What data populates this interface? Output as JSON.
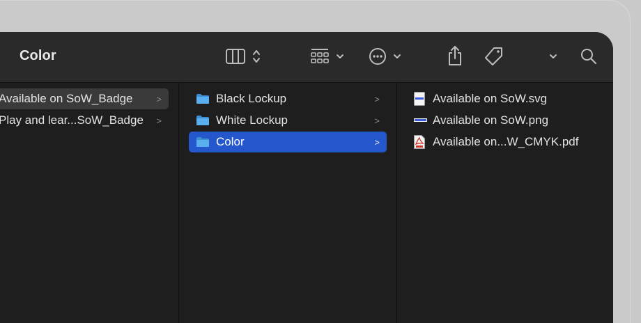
{
  "window": {
    "title": "Color"
  },
  "toolbar": {
    "icons": [
      "column-view-icon",
      "up-down-chevron-icon",
      "group-grid-icon",
      "chevron-down-icon",
      "more-actions-icon",
      "chevron-down-icon",
      "share-icon",
      "tag-icon",
      "chevron-down-icon",
      "search-icon"
    ]
  },
  "column1": {
    "items": [
      {
        "label": "Available on SoW_Badge",
        "selected": true
      },
      {
        "label": "Play and lear...SoW_Badge",
        "selected": false
      }
    ]
  },
  "column2": {
    "items": [
      {
        "label": "Black Lockup",
        "selected": false
      },
      {
        "label": "White Lockup",
        "selected": false
      },
      {
        "label": "Color",
        "selected": true
      }
    ]
  },
  "column3": {
    "items": [
      {
        "label": "Available on SoW.svg",
        "icon": "svg-file-icon"
      },
      {
        "label": "Available on SoW.png",
        "icon": "png-file-icon"
      },
      {
        "label": "Available on...W_CMYK.pdf",
        "icon": "pdf-file-icon"
      }
    ]
  },
  "colors": {
    "selection_blue": "#2457cc",
    "folder_blue": "#5ab0ef"
  }
}
